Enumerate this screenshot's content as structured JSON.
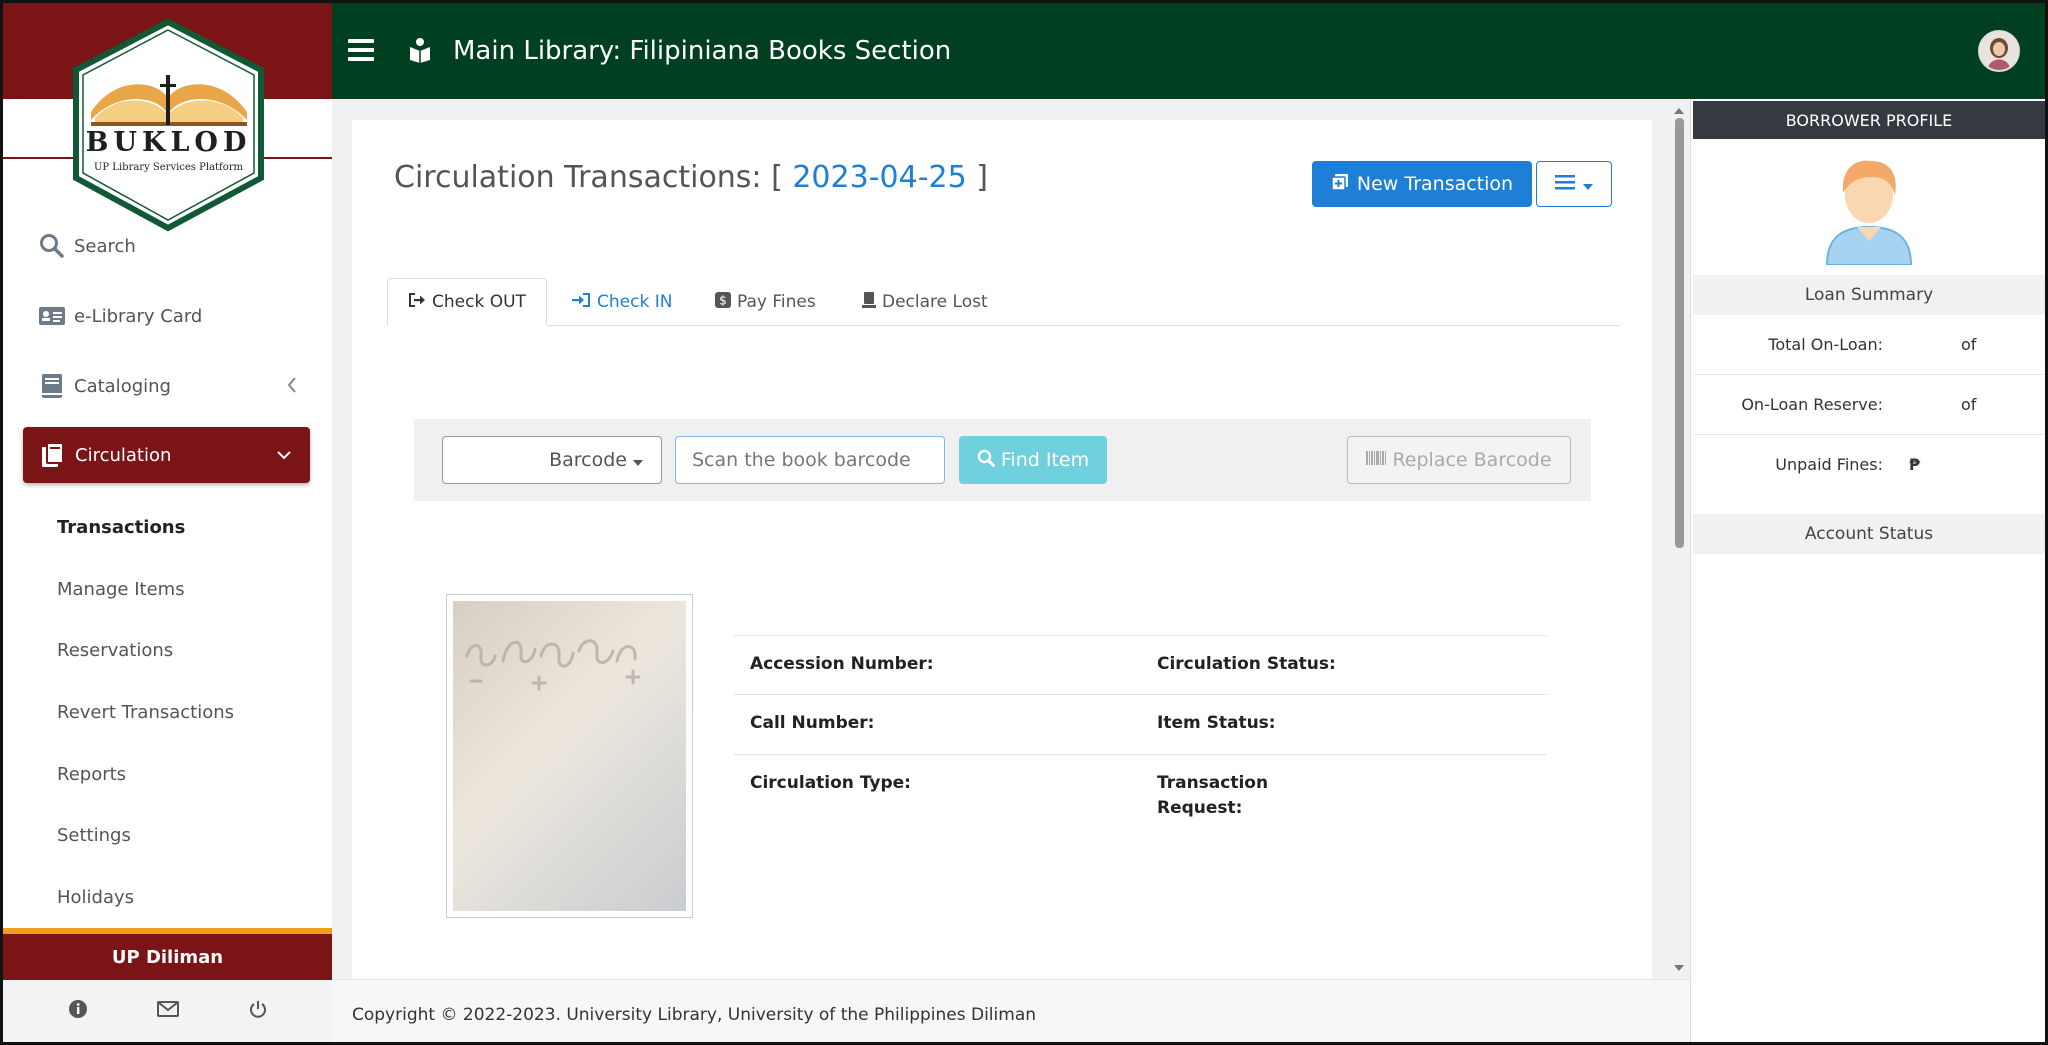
{
  "brand": {
    "logo_text": "BUKLOD",
    "logo_subtitle": "UP Library Services Platform"
  },
  "header": {
    "title": "Main Library: Filipiniana Books Section",
    "icons": [
      "hamburger-icon",
      "book-reader-icon",
      "user-avatar"
    ]
  },
  "sidebar": {
    "items": [
      {
        "label": "Search",
        "icon": "search-icon"
      },
      {
        "label": "e-Library Card",
        "icon": "id-card-icon"
      },
      {
        "label": "Cataloging",
        "icon": "book-icon"
      },
      {
        "label": "Circulation",
        "icon": "books-icon",
        "active": true
      }
    ],
    "subitems": [
      {
        "label": "Transactions",
        "active": true
      },
      {
        "label": "Manage Items"
      },
      {
        "label": "Reservations"
      },
      {
        "label": "Revert Transactions"
      },
      {
        "label": "Reports"
      },
      {
        "label": "Settings"
      },
      {
        "label": "Holidays"
      }
    ],
    "campus": "UP Diliman",
    "bottom_icons": [
      "info-icon",
      "mail-icon",
      "power-icon"
    ]
  },
  "main": {
    "title_prefix": "Circulation Transactions: [",
    "title_date": "2023-04-25",
    "title_suffix": "]",
    "new_transaction_label": "New Transaction",
    "tabs": [
      {
        "label": "Check OUT",
        "icon": "sign-out-icon"
      },
      {
        "label": "Check IN",
        "icon": "sign-in-icon"
      },
      {
        "label": "Pay Fines",
        "icon": "dollar-icon"
      },
      {
        "label": "Declare Lost",
        "icon": "lost-book-icon"
      }
    ],
    "search": {
      "select_value": "Barcode",
      "placeholder": "Scan the book barcode",
      "find_label": "Find Item",
      "replace_label": "Replace Barcode"
    },
    "item_fields": {
      "accession_number": "Accession Number:",
      "circulation_status": "Circulation Status:",
      "call_number": "Call Number:",
      "item_status": "Item Status:",
      "circulation_type": "Circulation Type:",
      "transaction_request_1": "Transaction",
      "transaction_request_2": "Request:"
    }
  },
  "footer": {
    "copyright": "Copyright © 2022-2023. University Library, University of the Philippines Diliman"
  },
  "borrower": {
    "header": "BORROWER PROFILE",
    "loan_summary": "Loan Summary",
    "rows": [
      {
        "label": "Total On-Loan:",
        "value": "of"
      },
      {
        "label": "On-Loan Reserve:",
        "value": "of"
      },
      {
        "label": "Unpaid Fines:",
        "value": "₱"
      }
    ],
    "account_status": "Account Status"
  },
  "colors": {
    "header_green": "#003f1f",
    "maroon": "#7b1416",
    "primary_blue": "#1e7fd6",
    "find_cyan": "#6fd0de",
    "accent_orange": "#f0a019"
  }
}
